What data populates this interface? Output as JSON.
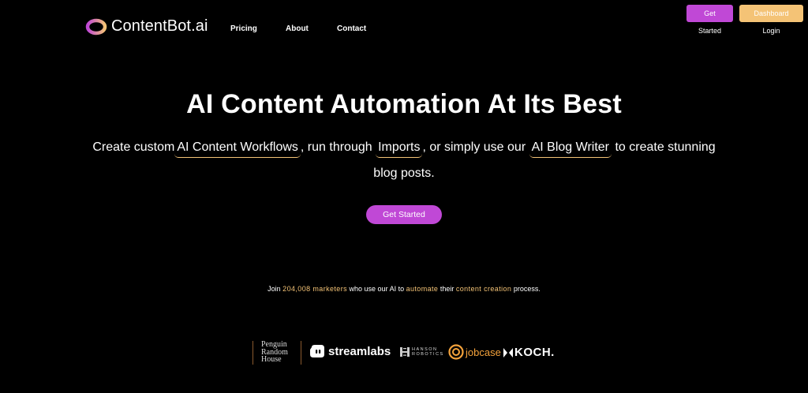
{
  "header": {
    "logo_text": "ContentBot.ai",
    "nav": {
      "pricing": "Pricing",
      "about": "About",
      "contact": "Contact"
    },
    "get_started_label": "Get Started",
    "dashboard_login_label": "Dashboard Login"
  },
  "hero": {
    "title": "AI Content Automation At Its Best",
    "sub_part1": "Create custom",
    "link_workflows": "AI Content Workflows",
    "sub_part2": ", run through",
    "link_imports": "Imports",
    "sub_part3": ", or simply use our",
    "link_blog_writer": "AI Blog Writer",
    "sub_part4": "to create stunning",
    "sub_line2": "blog posts.",
    "cta_label": "Get Started"
  },
  "social_proof": {
    "join_prefix": "Join",
    "marketer_count": "204,008 marketers",
    "mid1": "who use our AI to",
    "automate": "automate",
    "mid2": "their",
    "content_creation": "content creation",
    "suffix": "process."
  },
  "client_logos": {
    "penguin_line1": "Penguin",
    "penguin_line2": "Random",
    "penguin_line3": "House",
    "streamlabs": "streamlabs",
    "hanson_line1": "HANSON",
    "hanson_line2": "ROBOTICS",
    "jobcase": "jobcase",
    "koch": "KOCH."
  },
  "colors": {
    "background": "#000000",
    "purple_accent": "#c048d6",
    "gold_accent": "#f4c376",
    "jobcase_orange": "#f4a23b"
  }
}
